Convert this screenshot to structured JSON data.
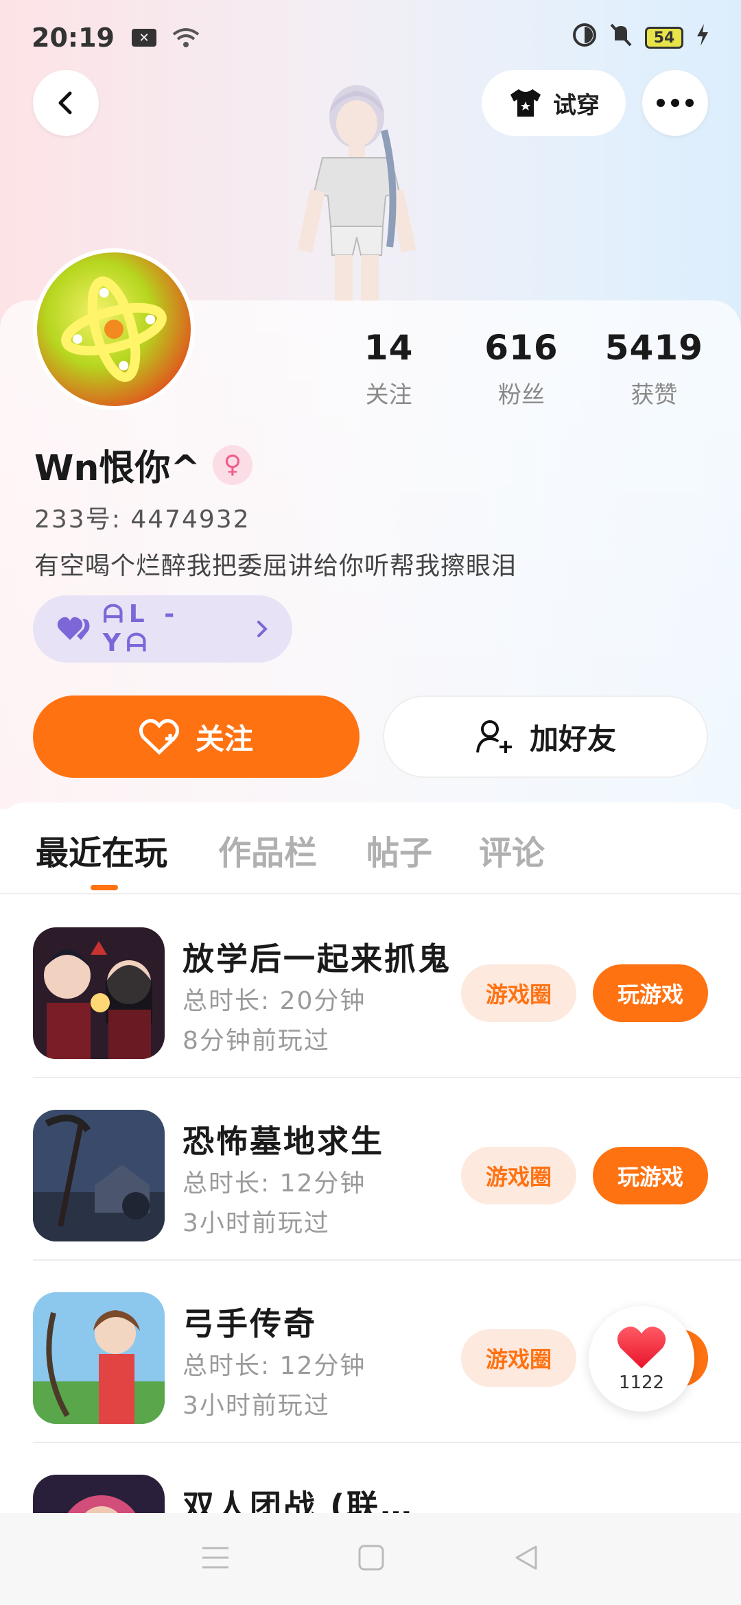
{
  "status": {
    "time": "20:19",
    "battery": "54"
  },
  "header": {
    "try_on_label": "试穿"
  },
  "profile": {
    "nickname": "Wn恨你^",
    "uid": "233号: 4474932",
    "bio": "有空喝个烂醉我把委屈讲给你听帮我擦眼泪",
    "cp_label": "ᗩL - YᗩRightarrow"
  },
  "stats": [
    {
      "num": "14",
      "label": "关注"
    },
    {
      "num": "616",
      "label": "粉丝"
    },
    {
      "num": "5419",
      "label": "获赞"
    }
  ],
  "actions": {
    "follow": "关注",
    "add_friend": "加好友"
  },
  "tabs": [
    "最近在玩",
    "作品栏",
    "帖子",
    "评论"
  ],
  "games": [
    {
      "title": "放学后一起来抓鬼",
      "duration": "总时长: 20分钟",
      "last": "8分钟前玩过",
      "circle": "游戏圈",
      "play": "玩游戏"
    },
    {
      "title": "恐怖墓地求生",
      "duration": "总时长: 12分钟",
      "last": "3小时前玩过",
      "circle": "游戏圈",
      "play": "玩游戏"
    },
    {
      "title": "弓手传奇",
      "duration": "总时长: 12分钟",
      "last": "3小时前玩过",
      "circle": "游戏圈",
      "play": "玩游戏"
    },
    {
      "title": "双人团战 (联…",
      "duration": "",
      "last": "",
      "circle": "",
      "play": ""
    }
  ],
  "floating": {
    "likes": "1122"
  },
  "colors": {
    "accent": "#ff7212",
    "cp": "#7d67d8"
  }
}
